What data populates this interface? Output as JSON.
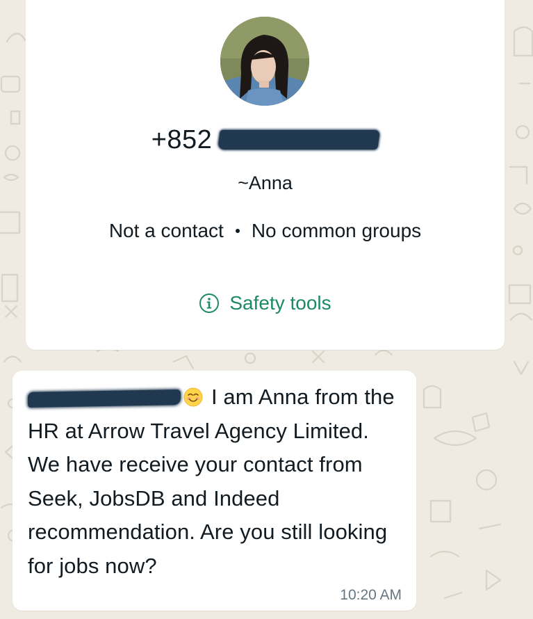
{
  "contact": {
    "phone_prefix": "+852",
    "name": "~Anna",
    "relationship": "Not a contact",
    "groups": "No common groups",
    "safety_label": "Safety tools"
  },
  "message": {
    "body": "I am Anna from the HR at Arrow Travel Agency Limited. We have receive your contact from Seek, JobsDB and Indeed recommendation. Are you still looking for jobs now?",
    "time": "10:20 AM"
  },
  "colors": {
    "chat_background": "#efeae2",
    "card_background": "#ffffff",
    "safety_link": "#1d8a62",
    "redaction": "#203850",
    "timestamp": "#667781"
  },
  "icons": {
    "avatar": "profile-photo",
    "safety": "info-icon",
    "emoji": "smiling-face-emoji"
  }
}
